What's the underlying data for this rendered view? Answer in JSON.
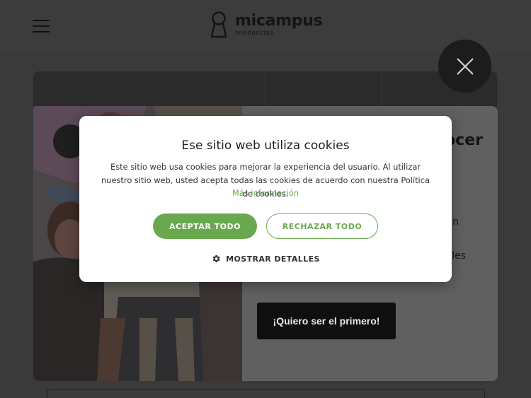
{
  "header": {
    "brand_name": "micampus",
    "brand_sub": "residencias"
  },
  "promo": {
    "heading_visible": "ocer",
    "line1_visible": "n",
    "line2_visible": "les",
    "cta_label": "¡Quiero ser el primero!"
  },
  "cookie_dialog": {
    "title": "Ese sitio web utiliza cookies",
    "body": "Este sitio web usa cookies para mejorar la experiencia del usuario. Al utilizar nuestro sitio web, usted acepta todas las cookies de acuerdo con nuestra Política de cookies.",
    "more_info": "Más información",
    "accept_label": "ACEPTAR TODO",
    "reject_label": "RECHAZAR TODO",
    "details_label": "MOSTRAR DETALLES"
  },
  "icons": {
    "menu": "hamburger-icon",
    "logo": "keyhole-person-icon",
    "close": "close-icon",
    "details": "gear-icon"
  },
  "colors": {
    "accent": "#6aa84f",
    "overlay": "#3a3a3a",
    "cta_bg": "#0f0f0f",
    "dialog_bg": "#ffffff"
  }
}
